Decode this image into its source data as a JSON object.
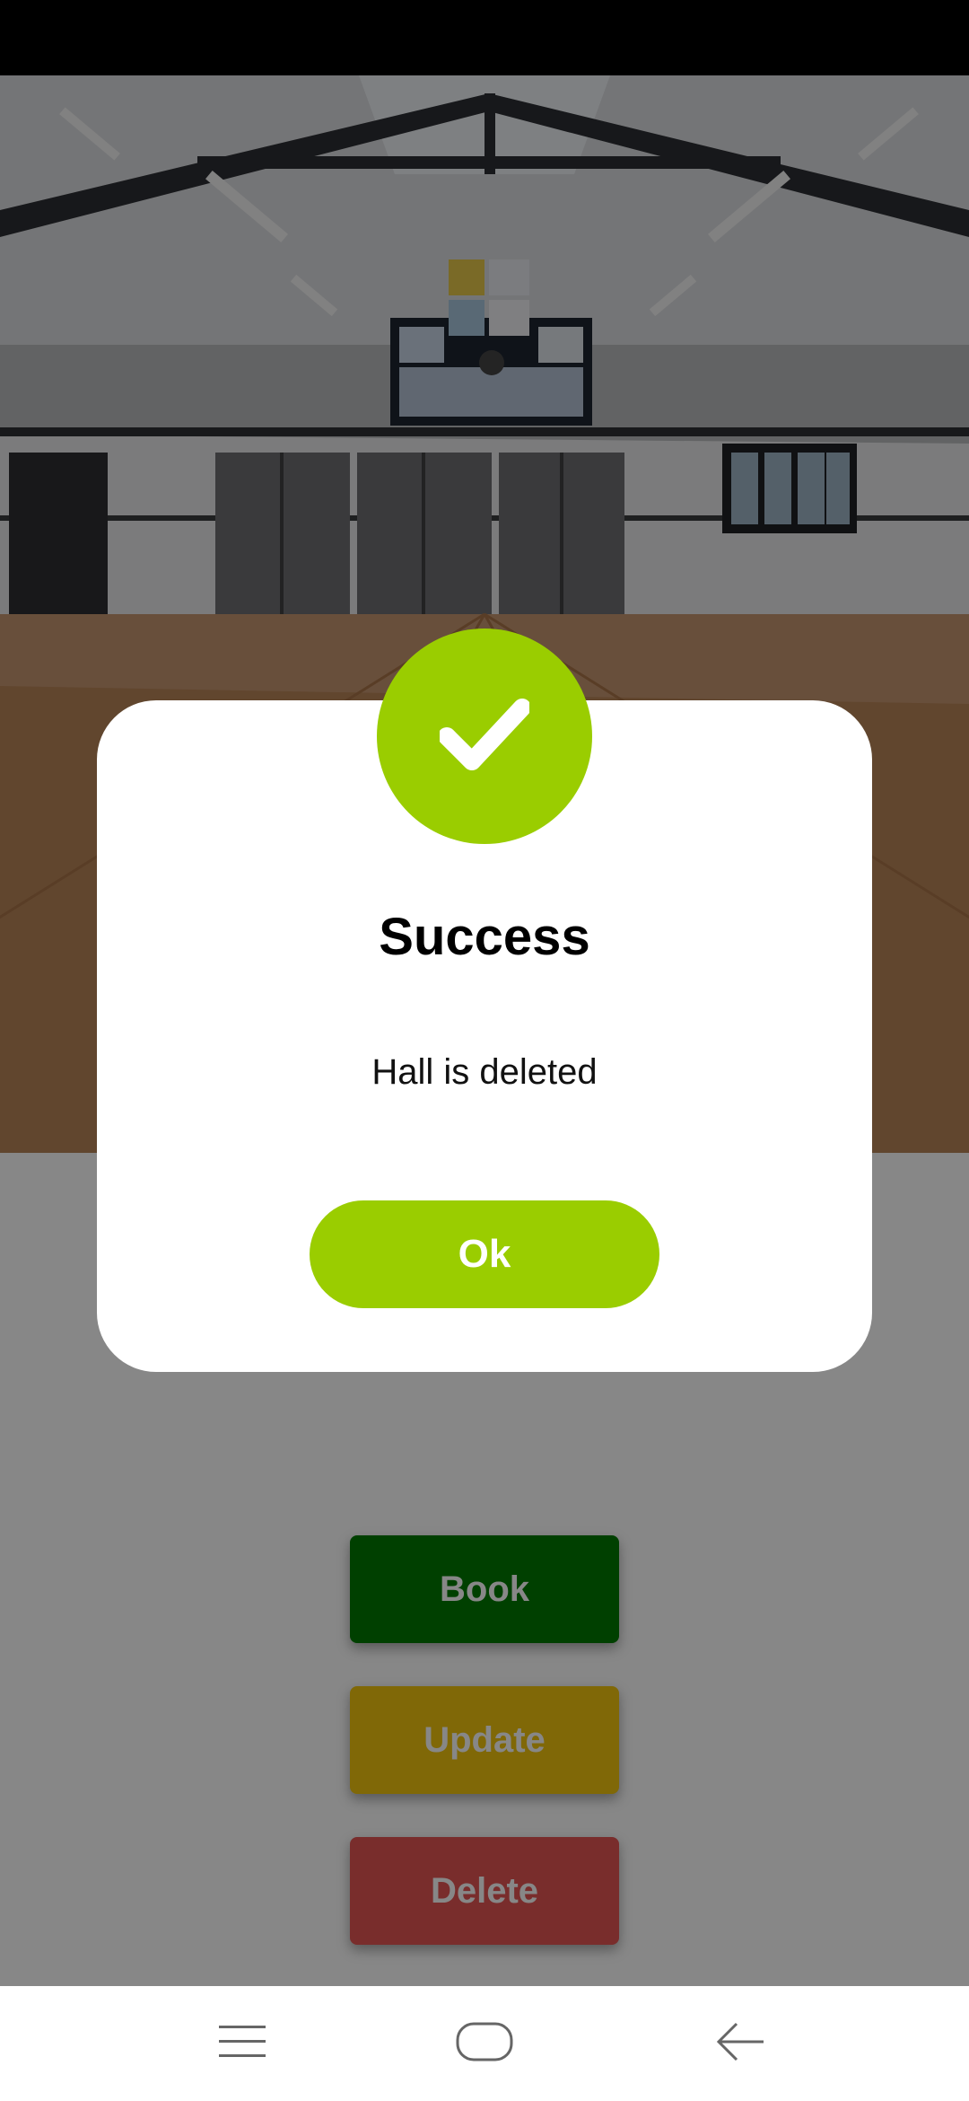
{
  "dialog": {
    "title": "Success",
    "message": "Hall is deleted",
    "ok_label": "Ok",
    "icon": "checkmark-icon",
    "accent_color": "#9acd00"
  },
  "actions": {
    "book_label": "Book",
    "update_label": "Update",
    "delete_label": "Delete"
  },
  "colors": {
    "book": "#007a00",
    "update": "#f1c40f",
    "delete": "#e45554"
  },
  "nav_bar": {
    "items": [
      "menu-icon",
      "home-icon",
      "back-icon"
    ]
  }
}
